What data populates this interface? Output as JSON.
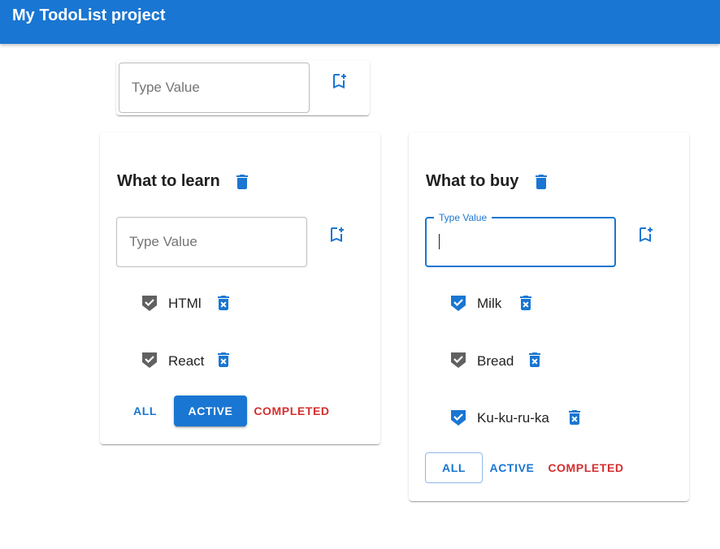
{
  "app": {
    "title": "My TodoList project"
  },
  "add_list": {
    "placeholder": "Type Value",
    "add_icon": "bookmark-add-icon"
  },
  "lists": [
    {
      "title": "What to learn",
      "input": {
        "placeholder": "Type Value",
        "value": ""
      },
      "tasks": [
        {
          "title": "HTMl",
          "checked": false
        },
        {
          "title": "React",
          "checked": false
        }
      ],
      "filters": {
        "all": "ALL",
        "active": "ACTIVE",
        "completed": "COMPLETED",
        "selected": "ACTIVE"
      }
    },
    {
      "title": "What to buy",
      "input": {
        "label": "Type Value",
        "value": ""
      },
      "tasks": [
        {
          "title": "Milk",
          "checked": true
        },
        {
          "title": "Bread",
          "checked": false
        },
        {
          "title": "Ku-ku-ru-ka",
          "checked": true
        }
      ],
      "filters": {
        "all": "ALL",
        "active": "ACTIVE",
        "completed": "COMPLETED",
        "selected": "ALL"
      }
    }
  ],
  "colors": {
    "primary": "#1976d2",
    "error": "#d32f2f",
    "unchecked": "#616161"
  }
}
